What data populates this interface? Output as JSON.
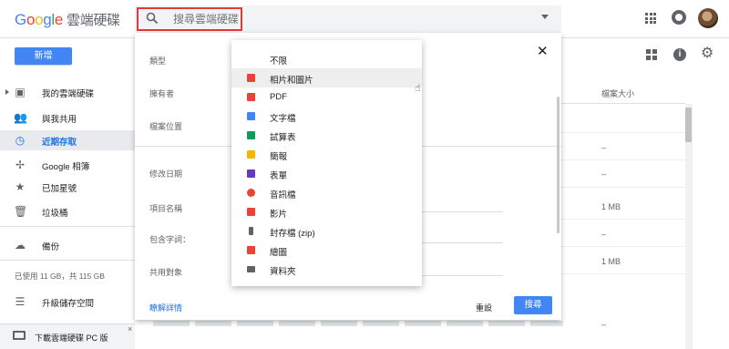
{
  "header": {
    "logo_letters": [
      "G",
      "o",
      "o",
      "g",
      "l",
      "e"
    ],
    "product": "雲端硬碟",
    "search": {
      "placeholder": "搜尋雲端硬碟"
    }
  },
  "toolbar": {
    "new_label": "新增"
  },
  "sidebar": {
    "items": [
      {
        "label": "我的雲端硬碟",
        "icon": "drive-icon"
      },
      {
        "label": "與我共用",
        "icon": "shared-icon"
      },
      {
        "label": "近期存取",
        "icon": "clock-icon",
        "active": true
      },
      {
        "label": "Google 相簿",
        "icon": "photos-icon"
      },
      {
        "label": "已加星號",
        "icon": "star-icon"
      },
      {
        "label": "垃圾桶",
        "icon": "trash-icon"
      },
      {
        "label": "備份",
        "icon": "cloud-icon"
      },
      {
        "label": "升級儲存空間",
        "icon": "storage-icon"
      }
    ],
    "storage_text": "已使用 11 GB，共 115 GB",
    "download_label": "下載雲端硬碟 PC 版",
    "download_close": "×"
  },
  "list": {
    "size_header": "檔案大小",
    "sizes": [
      "–",
      "–",
      "1 MB",
      "–",
      "1 MB",
      "–"
    ]
  },
  "panel": {
    "labels": {
      "type": "類型",
      "owner": "擁有者",
      "location": "檔案位置",
      "modified": "修改日期",
      "item_name": "項目名稱",
      "contains": "包含字詞：",
      "shared_with": "共用對象"
    },
    "learn_more": "瞭解詳情",
    "reset": "重設",
    "search": "搜尋",
    "close": "✕"
  },
  "type_dropdown": {
    "options": [
      {
        "label": "不限",
        "color": ""
      },
      {
        "label": "相片和圖片",
        "color": "#ea4335",
        "highlighted": true
      },
      {
        "label": "PDF",
        "color": "#ea4335"
      },
      {
        "label": "文字檔",
        "color": "#4285f4"
      },
      {
        "label": "試算表",
        "color": "#0f9d58"
      },
      {
        "label": "簡報",
        "color": "#f4b400"
      },
      {
        "label": "表單",
        "color": "#673ab7"
      },
      {
        "label": "音訊檔",
        "color": "#ea4335"
      },
      {
        "label": "影片",
        "color": "#ea4335"
      },
      {
        "label": "封存檔 (zip)",
        "color": "#5f6368"
      },
      {
        "label": "繪圖",
        "color": "#ea4335"
      },
      {
        "label": "資料夾",
        "color": "#5f6368"
      }
    ]
  }
}
